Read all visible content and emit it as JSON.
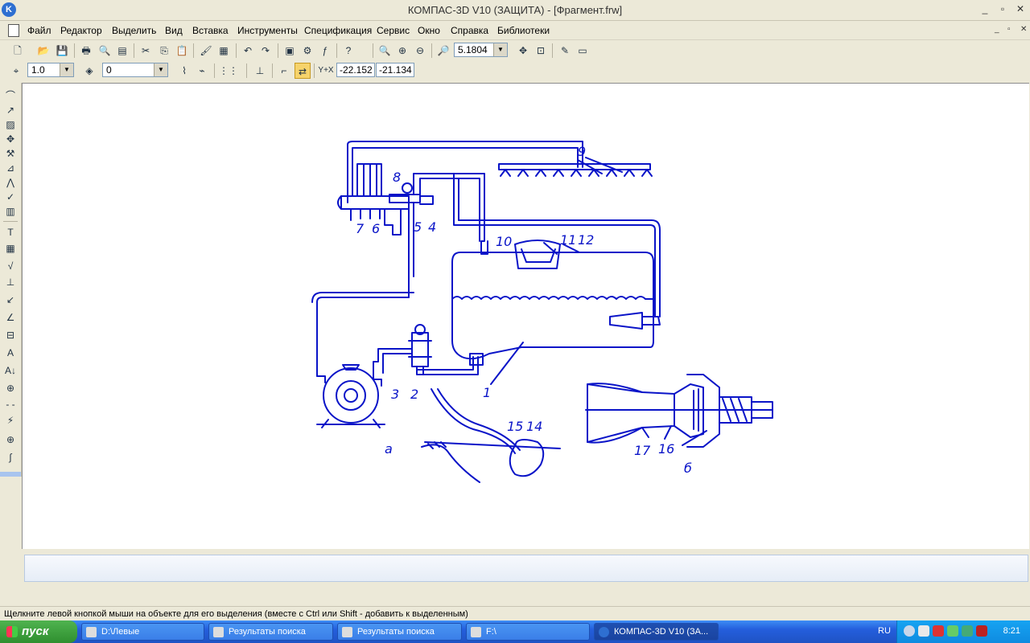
{
  "window": {
    "title": "КОМПАС-3D V10 (ЗАЩИТА) - [Фрагмент.frw]",
    "app_icon_glyph": "K"
  },
  "menu": {
    "items": [
      "Файл",
      "Редактор",
      "Выделить",
      "Вид",
      "Вставка",
      "Инструменты",
      "Спецификация",
      "Сервис",
      "Окно",
      "Справка",
      "Библиотеки"
    ]
  },
  "toolbar1": {
    "zoom_value": "5.1804"
  },
  "toolbar2": {
    "step_value": "1.0",
    "layer_value": "0",
    "coord_x": "-22.152",
    "coord_y": "-21.134",
    "coord_label": "Y+X"
  },
  "drawing": {
    "labels": [
      "1",
      "2",
      "3",
      "4",
      "5",
      "6",
      "7",
      "8",
      "9",
      "10",
      "11",
      "12",
      "14",
      "15",
      "16",
      "17",
      "а",
      "б"
    ],
    "line_color": "#0a14c8"
  },
  "statusbar": {
    "hint": "Щелкните левой кнопкой мыши на объекте для его выделения (вместе с Ctrl или Shift - добавить к выделенным)"
  },
  "taskbar": {
    "start_label": "пуск",
    "tasks": [
      {
        "label": "D:\\Левые"
      },
      {
        "label": "Результаты поиска"
      },
      {
        "label": "Результаты поиска"
      },
      {
        "label": "F:\\"
      },
      {
        "label": "КОМПАС-3D V10 (ЗА..."
      }
    ],
    "language": "RU",
    "clock": "8:21"
  }
}
